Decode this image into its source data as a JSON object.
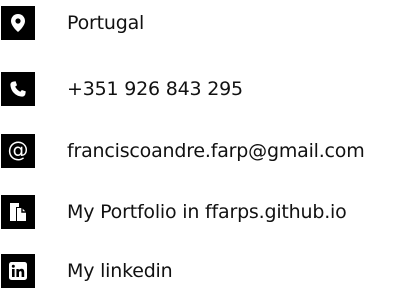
{
  "contacts": [
    {
      "icon": "map-marker-icon",
      "text": "Portugal"
    },
    {
      "icon": "phone-icon",
      "text": "+351 926 843 295"
    },
    {
      "icon": "at-icon",
      "glyph": "@",
      "text": "franciscoandre.farp@gmail.com"
    },
    {
      "icon": "portfolio-icon",
      "text": "My Portfolio in ffarps.github.io"
    },
    {
      "icon": "linkedin-icon",
      "text": "My linkedin"
    }
  ],
  "colors": {
    "icon_background": "#000000",
    "icon_foreground": "#ffffff",
    "text": "#111111",
    "page_background": "#ffffff"
  }
}
